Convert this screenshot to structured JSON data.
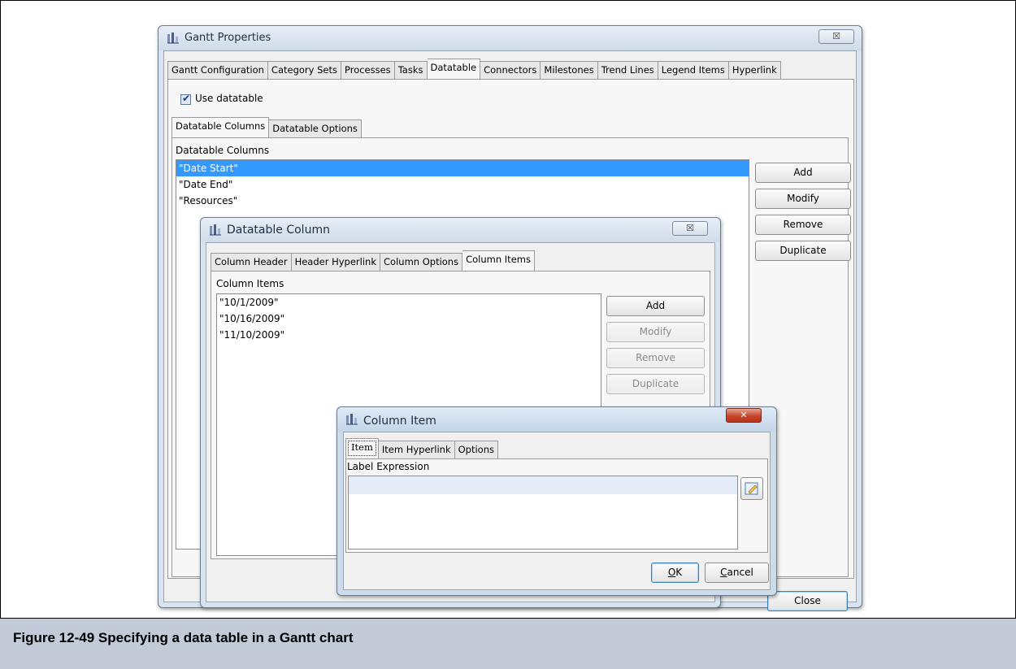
{
  "gantt_properties": {
    "title": "Gantt Properties",
    "close_glyph": "☒",
    "tabs": [
      "Gantt Configuration",
      "Category Sets",
      "Processes",
      "Tasks",
      "Datatable",
      "Connectors",
      "Milestones",
      "Trend Lines",
      "Legend Items",
      "Hyperlink"
    ],
    "active_tab": "Datatable",
    "use_datatable_label": "Use datatable",
    "use_datatable_checked": true,
    "subtabs": [
      "Datatable Columns",
      "Datatable Options"
    ],
    "active_subtab": "Datatable Columns",
    "columns_heading": "Datatable Columns",
    "columns": [
      "\"Date Start\"",
      "\"Date End\"",
      "\"Resources\""
    ],
    "selected_column": "\"Date Start\"",
    "buttons": {
      "add": "Add",
      "modify": "Modify",
      "remove": "Remove",
      "duplicate": "Duplicate",
      "close": "Close"
    }
  },
  "datatable_column": {
    "title": "Datatable Column",
    "tabs": [
      "Column Header",
      "Header Hyperlink",
      "Column Options",
      "Column Items"
    ],
    "active_tab": "Column Items",
    "items_heading": "Column Items",
    "items": [
      "\"10/1/2009\"",
      "\"10/16/2009\"",
      "\"11/10/2009\""
    ],
    "buttons": {
      "add": "Add",
      "modify": "Modify",
      "remove": "Remove",
      "duplicate": "Duplicate"
    }
  },
  "column_item": {
    "title": "Column Item",
    "close_glyph": "✕",
    "tabs": [
      "Item",
      "Item Hyperlink",
      "Options"
    ],
    "active_tab": "Item",
    "label_expression_heading": "Label Expression",
    "label_expression_value": "",
    "buttons": {
      "ok_mnemonic": "O",
      "ok_rest": "K",
      "cancel_mnemonic": "C",
      "cancel_rest": "ancel"
    }
  },
  "caption": "Figure 12-49  Specifying a data table in a Gantt chart"
}
